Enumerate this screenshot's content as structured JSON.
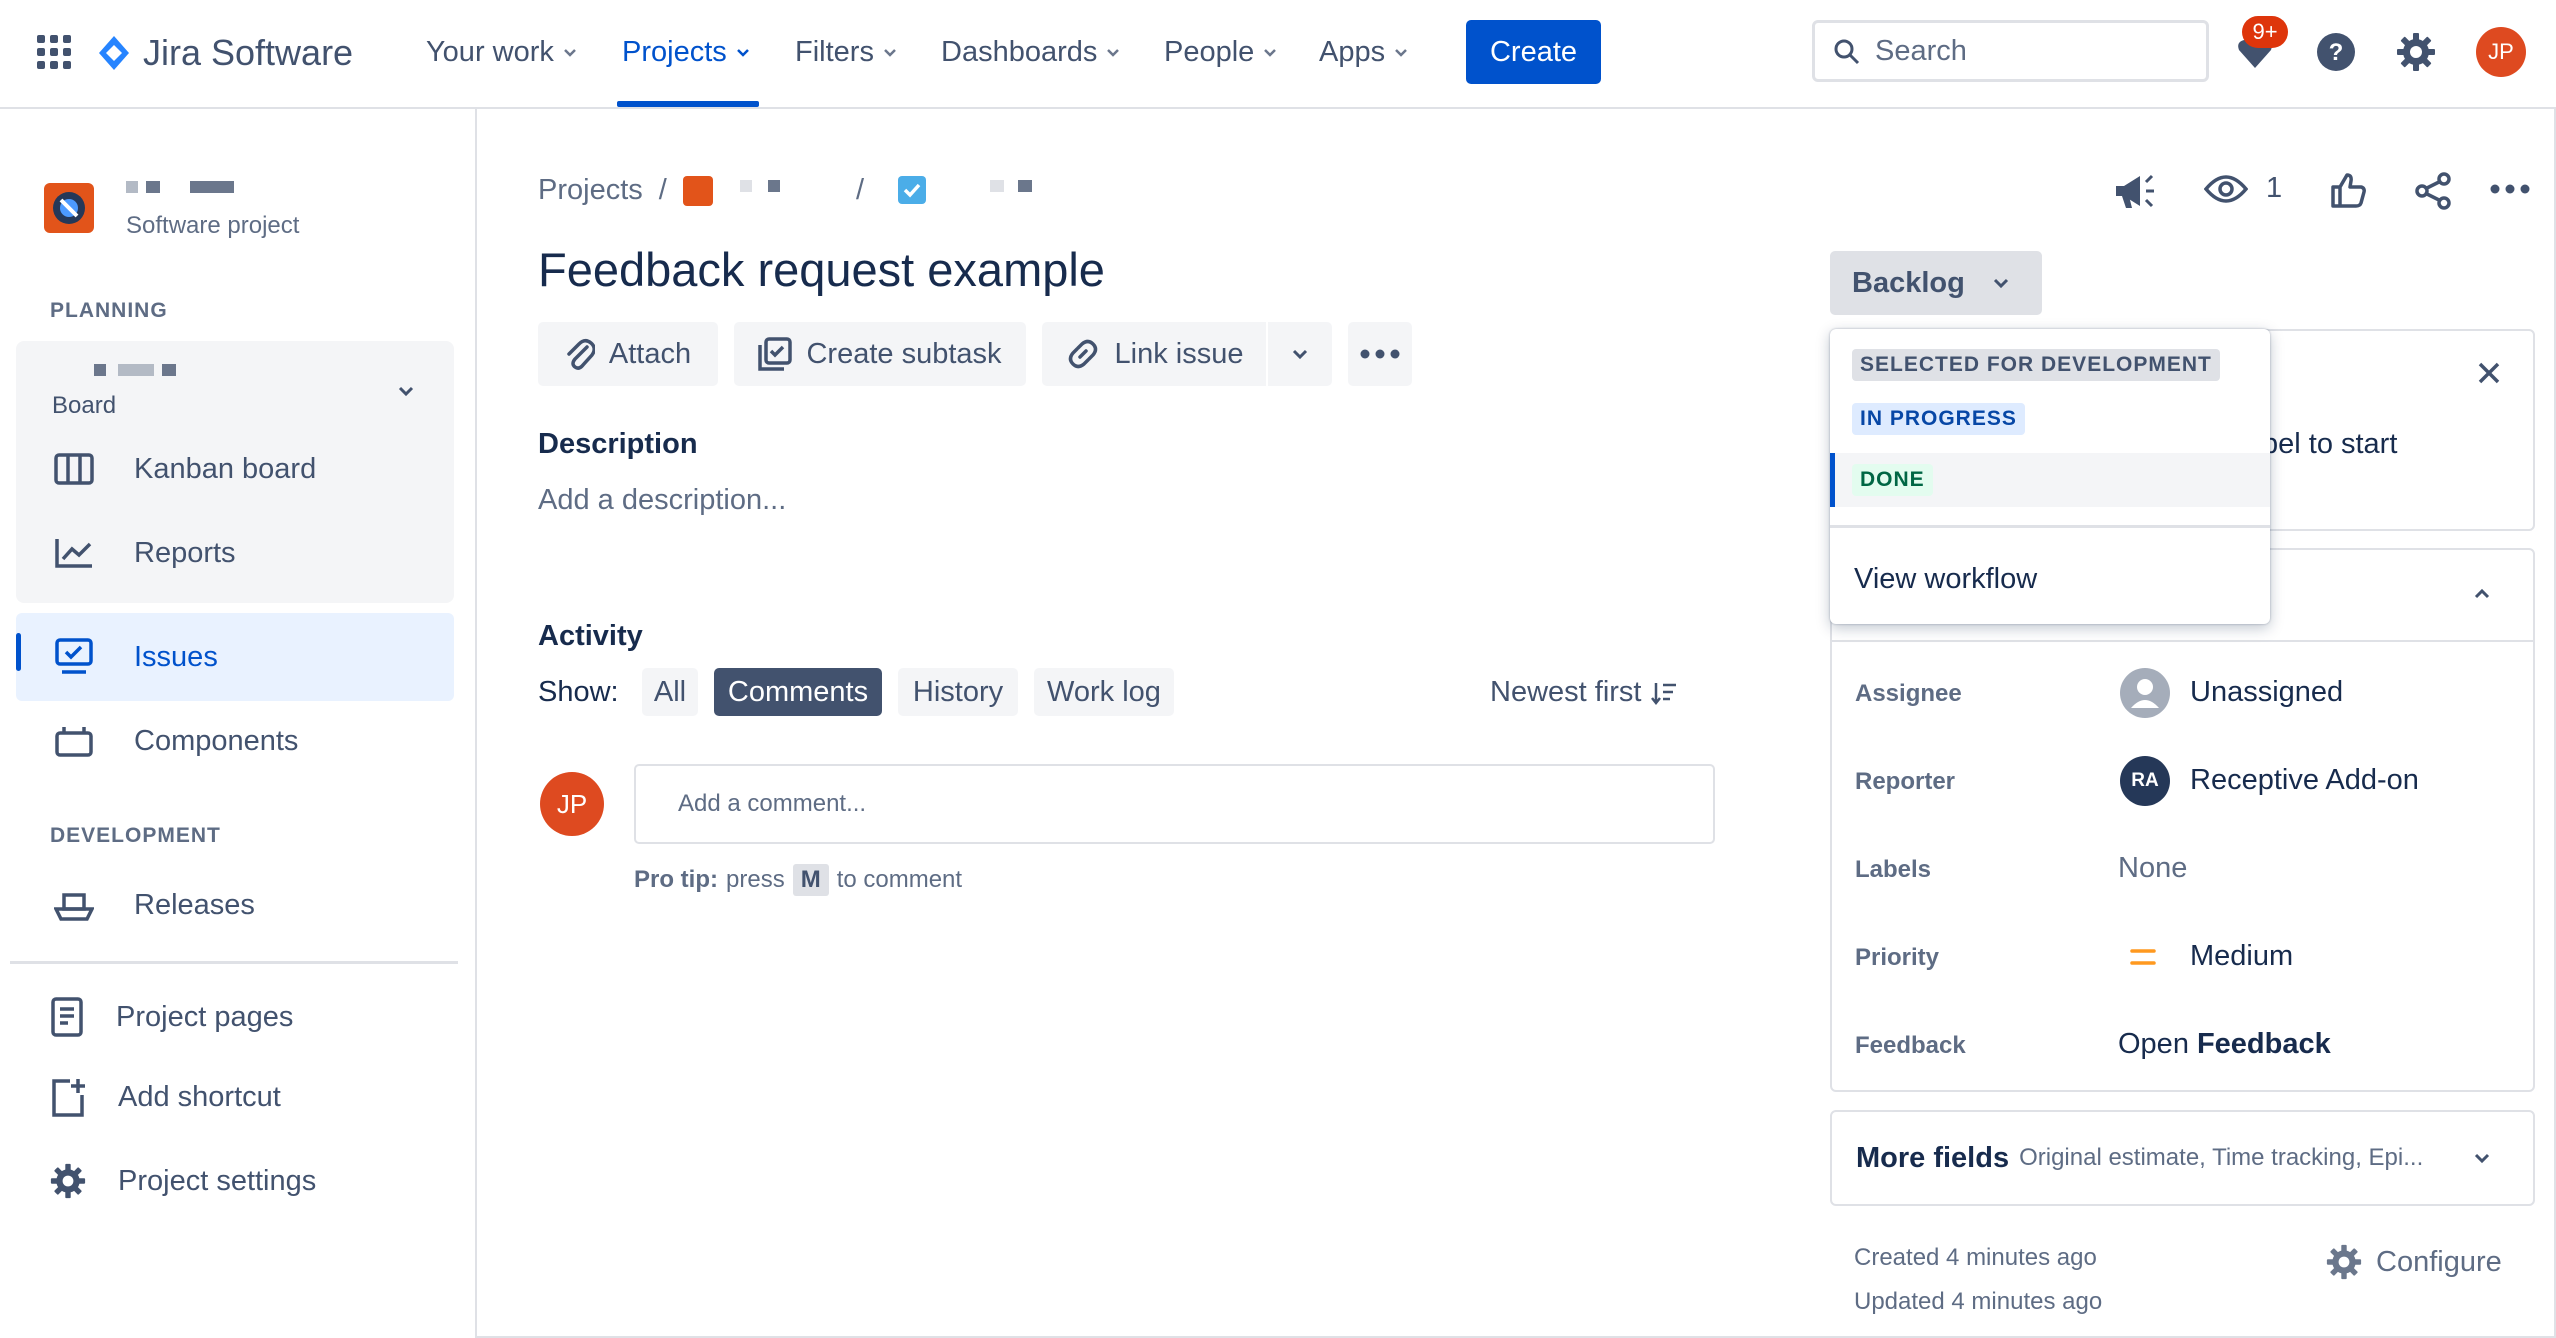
{
  "nav": {
    "app_name": "Jira Software",
    "items": [
      {
        "label": "Your work"
      },
      {
        "label": "Projects"
      },
      {
        "label": "Filters"
      },
      {
        "label": "Dashboards"
      },
      {
        "label": "People"
      },
      {
        "label": "Apps"
      }
    ],
    "create_label": "Create",
    "search_placeholder": "Search",
    "notification_count": "9+",
    "avatar_initials": "JP"
  },
  "sidebar": {
    "project_type": "Software project",
    "planning_label": "PLANNING",
    "board_label": "Board",
    "items": [
      {
        "label": "Kanban board"
      },
      {
        "label": "Reports"
      },
      {
        "label": "Issues"
      },
      {
        "label": "Components"
      }
    ],
    "development_label": "DEVELOPMENT",
    "releases_label": "Releases",
    "bottom_items": [
      {
        "label": "Project pages"
      },
      {
        "label": "Add shortcut"
      },
      {
        "label": "Project settings"
      }
    ]
  },
  "issue": {
    "breadcrumb_root": "Projects",
    "title": "Feedback request example",
    "actions": {
      "attach": "Attach",
      "create_subtask": "Create subtask",
      "link_issue": "Link issue"
    },
    "description_label": "Description",
    "description_placeholder": "Add a description...",
    "activity_label": "Activity",
    "show_label": "Show:",
    "filters": [
      {
        "label": "All"
      },
      {
        "label": "Comments"
      },
      {
        "label": "History"
      },
      {
        "label": "Work log"
      }
    ],
    "sort_label": "Newest first",
    "comment_placeholder": "Add a comment...",
    "protip_prefix": "Pro tip:",
    "protip_press": "press",
    "protip_key": "M",
    "protip_suffix": "to comment",
    "commenter_initials": "JP"
  },
  "right": {
    "watchers_count": "1",
    "status_button": "Backlog",
    "dropdown": {
      "statuses": [
        {
          "label": "SELECTED FOR DEVELOPMENT"
        },
        {
          "label": "IN PROGRESS"
        },
        {
          "label": "DONE"
        }
      ],
      "view_workflow": "View workflow"
    },
    "hint_text_fragment": "bel to start",
    "fields": {
      "assignee_label": "Assignee",
      "assignee_value": "Unassigned",
      "reporter_label": "Reporter",
      "reporter_initials": "RA",
      "reporter_value": "Receptive Add-on",
      "labels_label": "Labels",
      "labels_value": "None",
      "priority_label": "Priority",
      "priority_value": "Medium",
      "feedback_label": "Feedback",
      "feedback_prefix": "Open",
      "feedback_value": "Feedback"
    },
    "more_fields_label": "More fields",
    "more_fields_hint": "Original estimate, Time tracking, Epi...",
    "created": "Created 4 minutes ago",
    "updated": "Updated 4 minutes ago",
    "configure_label": "Configure"
  },
  "colors": {
    "brand": "#0052CC",
    "text": "#172B4D",
    "subtle": "#42526E",
    "done": "#006644",
    "in_progress": "#0747A6",
    "priority_medium": "#FF991F"
  }
}
